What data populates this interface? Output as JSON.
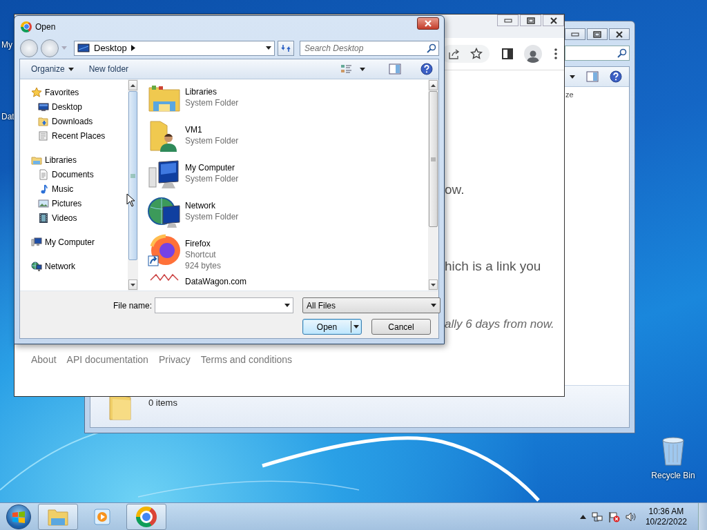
{
  "desktop": {
    "icons": [
      {
        "label": "My"
      },
      {
        "label": "Dat"
      }
    ],
    "recycle_bin": {
      "label": "Recycle Bin"
    }
  },
  "explorer_window": {
    "column_3": "ze",
    "status": "0 items"
  },
  "browser_window": {
    "content": [
      {
        "text": "ow.",
        "kind": "plain"
      },
      {
        "text": "hich is a link you",
        "kind": "plain"
      },
      {
        "text": "ally 6 days from now.",
        "kind": "italic"
      }
    ],
    "footer_links": [
      "About",
      "API documentation",
      "Privacy",
      "Terms and conditions"
    ]
  },
  "open_dialog": {
    "title": "Open",
    "address": "Desktop",
    "search": {
      "placeholder": "Search Desktop"
    },
    "toolbar": [
      "Organize",
      "New folder"
    ],
    "nav": [
      {
        "label": "Favorites",
        "kind": "star",
        "children": [
          {
            "label": "Desktop",
            "kind": "desktop"
          },
          {
            "label": "Downloads",
            "kind": "download"
          },
          {
            "label": "Recent Places",
            "kind": "recent"
          }
        ]
      },
      {
        "label": "Libraries",
        "kind": "library",
        "children": [
          {
            "label": "Documents",
            "kind": "document"
          },
          {
            "label": "Music",
            "kind": "music"
          },
          {
            "label": "Pictures",
            "kind": "picture"
          },
          {
            "label": "Videos",
            "kind": "video"
          }
        ]
      },
      {
        "label": "My Computer",
        "kind": "computer"
      },
      {
        "label": "Network",
        "kind": "network"
      }
    ],
    "items": [
      {
        "name": "Libraries",
        "kind": "libraries",
        "details": [
          "System Folder"
        ]
      },
      {
        "name": "VM1",
        "kind": "user",
        "details": [
          "System Folder"
        ]
      },
      {
        "name": "My Computer",
        "kind": "computer",
        "details": [
          "System Folder"
        ]
      },
      {
        "name": "Network",
        "kind": "network",
        "details": [
          "System Folder"
        ]
      },
      {
        "name": "Firefox",
        "kind": "shortcut",
        "details": [
          "Shortcut",
          "924 bytes"
        ]
      },
      {
        "name": "DataWagon.com",
        "kind": "website"
      }
    ],
    "file_name_label": "File name:",
    "file_type": "All Files",
    "buttons": [
      "Open",
      "Cancel"
    ]
  },
  "taskbar": {
    "clock": {
      "time": "10:36 AM",
      "date": "10/22/2022"
    }
  }
}
